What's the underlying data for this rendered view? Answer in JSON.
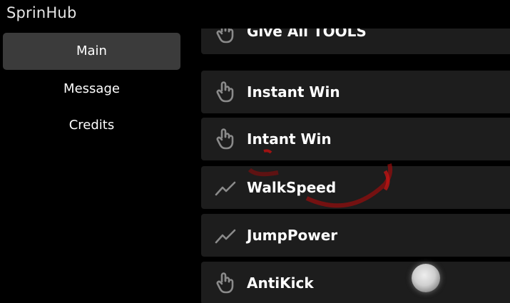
{
  "window": {
    "title": "SprinHub"
  },
  "sidebar": {
    "items": [
      {
        "label": "Main",
        "active": true
      },
      {
        "label": "Message",
        "active": false
      },
      {
        "label": "Credits",
        "active": false
      }
    ]
  },
  "buttons": [
    {
      "label": "Give All TOOLS",
      "icon": "pointer-hand-icon"
    },
    {
      "label": "Instant Win",
      "icon": "pointer-hand-icon"
    },
    {
      "label": "Intant Win",
      "icon": "pointer-hand-icon"
    },
    {
      "label": "WalkSpeed",
      "icon": "trend-line-icon"
    },
    {
      "label": "JumpPower",
      "icon": "trend-line-icon"
    },
    {
      "label": "AntiKick",
      "icon": "pointer-hand-icon"
    }
  ],
  "colors": {
    "background": "#000000",
    "active_nav": "#3b3b3b",
    "row_bg": "#1d1d1d",
    "icon": "#8a8a8a",
    "text": "#ffffff"
  }
}
